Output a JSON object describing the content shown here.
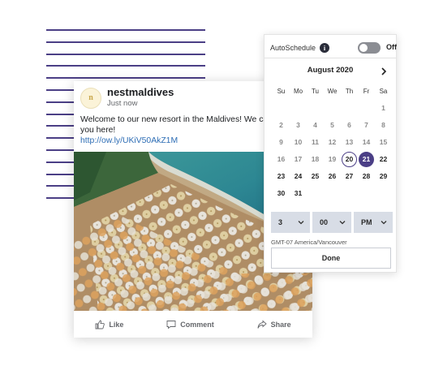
{
  "post": {
    "author": "nestmaldives",
    "avatar_initial": "n",
    "time": "Just now",
    "text_lines": [
      "Welcome to our new resort in the Maldives! We can't",
      "you here!"
    ],
    "link": "http://ow.ly/UKiV50AkZ1M",
    "actions": {
      "like": "Like",
      "comment": "Comment",
      "share": "Share"
    }
  },
  "schedule": {
    "auto_label": "AutoSchedule",
    "info_glyph": "i",
    "toggle_state": "Off",
    "month": "August 2020",
    "weekdays": [
      "Su",
      "Mo",
      "Tu",
      "We",
      "Th",
      "Fr",
      "Sa"
    ],
    "weeks": [
      [
        "",
        "",
        "",
        "",
        "",
        "",
        "1"
      ],
      [
        "2",
        "3",
        "4",
        "5",
        "6",
        "7",
        "8"
      ],
      [
        "9",
        "10",
        "11",
        "12",
        "13",
        "14",
        "15"
      ],
      [
        "16",
        "17",
        "18",
        "19",
        "20",
        "21",
        "22"
      ],
      [
        "23",
        "24",
        "25",
        "26",
        "27",
        "28",
        "29"
      ],
      [
        "30",
        "31",
        "",
        "",
        "",
        "",
        ""
      ]
    ],
    "today": "20",
    "selected": "21",
    "hour": "3",
    "minute": "00",
    "ampm": "PM",
    "timezone": "GMT-07 America/Vancouver",
    "done_label": "Done"
  },
  "colors": {
    "accent": "#4b3f86",
    "link": "#2d6db5",
    "toggle_off": "#8b8d93"
  }
}
